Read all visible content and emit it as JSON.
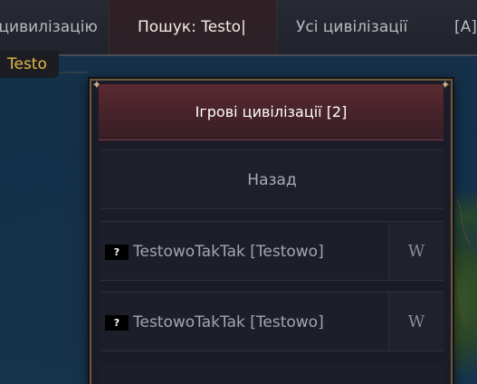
{
  "topbar": {
    "left_label": "и цивилізацію",
    "search_label": "Пошук: Testo|",
    "all_label": "Усі цивілізації",
    "filter_label": "[A]"
  },
  "suggestion": "Testo",
  "panel": {
    "title": "Ігрові цивілізації [2]",
    "back_label": "Назад",
    "rows": [
      {
        "badge": "?",
        "name": "TestowoTakTak [Testowo]",
        "wiki": "W"
      },
      {
        "badge": "?",
        "name": "TestowoTakTak [Testowo]",
        "wiki": "W"
      }
    ]
  },
  "colors": {
    "accent": "#e4b847",
    "header_red": "#5a2a31",
    "panel_bg": "#1b1c27",
    "frame_gold": "#6b5a3e"
  },
  "icons": {
    "corner": "ornament-corner-icon",
    "wiki": "wikipedia-icon"
  }
}
